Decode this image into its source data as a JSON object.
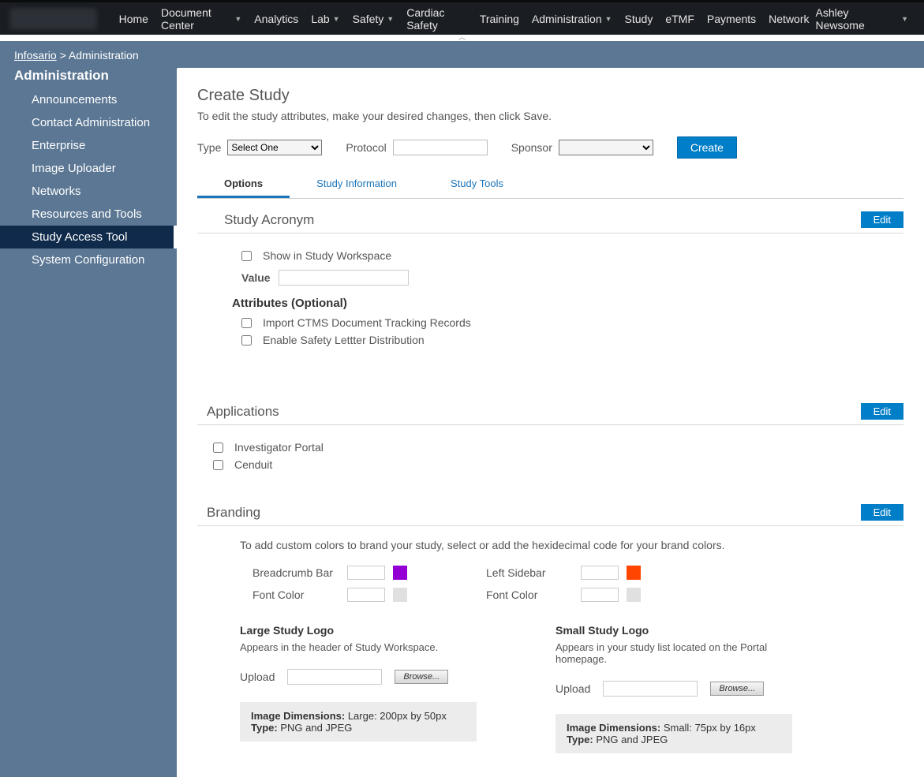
{
  "topnav": {
    "items": [
      {
        "label": "Home",
        "dropdown": false
      },
      {
        "label": "Document Center",
        "dropdown": true
      },
      {
        "label": "Analytics",
        "dropdown": false
      },
      {
        "label": "Lab",
        "dropdown": true
      },
      {
        "label": "Safety",
        "dropdown": true
      },
      {
        "label": "Cardiac Safety",
        "dropdown": false
      },
      {
        "label": "Training",
        "dropdown": false
      },
      {
        "label": "Administration",
        "dropdown": true
      },
      {
        "label": "Study",
        "dropdown": false
      },
      {
        "label": "eTMF",
        "dropdown": false
      },
      {
        "label": "Payments",
        "dropdown": false
      },
      {
        "label": "Network",
        "dropdown": false
      }
    ],
    "user": "Ashley Newsome"
  },
  "breadcrumb": {
    "root": "Infosario",
    "sep": ">",
    "current": "Administration"
  },
  "sidebar": {
    "title": "Administration",
    "items": [
      {
        "label": "Announcements",
        "active": false
      },
      {
        "label": "Contact Administration",
        "active": false
      },
      {
        "label": "Enterprise",
        "active": false
      },
      {
        "label": "Image Uploader",
        "active": false
      },
      {
        "label": "Networks",
        "active": false
      },
      {
        "label": "Resources and Tools",
        "active": false
      },
      {
        "label": "Study Access Tool",
        "active": true
      },
      {
        "label": "System Configuration",
        "active": false
      }
    ]
  },
  "page": {
    "title": "Create Study",
    "desc": "To edit the study attributes, make your desired changes, then click Save.",
    "type_label": "Type",
    "type_selected": "Select One",
    "protocol_label": "Protocol",
    "protocol_value": "",
    "sponsor_label": "Sponsor",
    "sponsor_selected": "",
    "create_btn": "Create"
  },
  "tabs": [
    {
      "label": "Options",
      "active": true
    },
    {
      "label": "Study Information",
      "active": false
    },
    {
      "label": "Study Tools",
      "active": false
    }
  ],
  "edit_label": "Edit",
  "acronym": {
    "title": "Study Acronym",
    "show_workspace": "Show in Study Workspace",
    "value_label": "Value",
    "value": "",
    "attributes_title": "Attributes (Optional)",
    "attr1": "Import CTMS Document Tracking Records",
    "attr2": "Enable Safety Lettter Distribution"
  },
  "applications": {
    "title": "Applications",
    "items": [
      "Investigator Portal",
      "Cenduit"
    ]
  },
  "branding": {
    "title": "Branding",
    "desc": "To add custom colors to brand your study, select or add the hexidecimal code for your brand colors.",
    "rows": {
      "breadcrumb_label": "Breadcrumb Bar",
      "breadcrumb_color": "#9400d3",
      "font1_label": "Font Color",
      "font1_color": "#e0e0e0",
      "leftsidebar_label": "Left Sidebar",
      "leftsidebar_color": "#ff4500",
      "font2_label": "Font Color",
      "font2_color": "#e0e0e0"
    },
    "large_logo": {
      "title": "Large Study Logo",
      "desc": "Appears in the header of Study Workspace.",
      "upload_label": "Upload",
      "browse": "Browse...",
      "dim_label": "Image Dimensions:",
      "dim_value": " Large: 200px by 50px",
      "type_label": "Type:",
      "type_value": " PNG and JPEG"
    },
    "small_logo": {
      "title": "Small Study Logo",
      "desc": "Appears in your study list located on the Portal homepage.",
      "upload_label": "Upload",
      "browse": "Browse...",
      "dim_label": "Image Dimensions:",
      "dim_value": " Small: 75px by 16px",
      "type_label": "Type:",
      "type_value": " PNG and JPEG"
    }
  }
}
